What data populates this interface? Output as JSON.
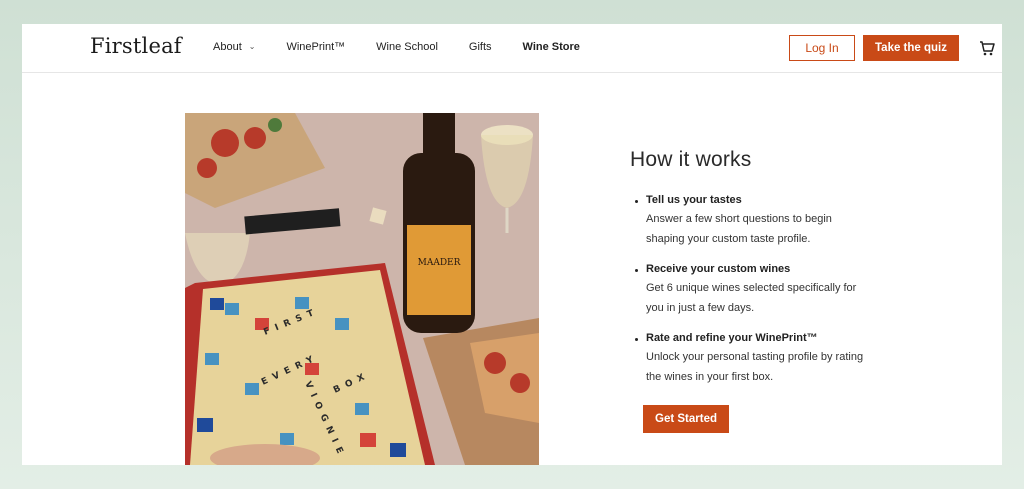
{
  "header": {
    "logo": "Firstleaf",
    "nav": [
      {
        "label": "About",
        "has_dropdown": true
      },
      {
        "label": "WinePrint™"
      },
      {
        "label": "Wine School"
      },
      {
        "label": "Gifts"
      },
      {
        "label": "Wine Store",
        "bold": true
      }
    ],
    "login_label": "Log In",
    "quiz_label": "Take the quiz",
    "cart_icon": "cart-icon"
  },
  "main": {
    "title": "How it works",
    "steps": [
      {
        "title": "Tell us your tastes",
        "desc_line1": "Answer a few short questions to begin",
        "desc_line2": "shaping your custom taste profile."
      },
      {
        "title": "Receive your custom wines",
        "desc_line1": "Get 6 unique wines selected specifically for",
        "desc_line2": "you in just a few days."
      },
      {
        "title": "Rate and refine your WinePrint™",
        "desc_line1": "Unlock your personal tasting profile by rating",
        "desc_line2": "the wines in your first box."
      }
    ],
    "cta_label": "Get Started"
  },
  "photo": {
    "bottle_label": "MAADER",
    "tiles_word1": "FIRST",
    "tiles_word2": "EVERY",
    "tiles_word3": "BOX",
    "tiles_word4": "VIOGNIE"
  },
  "colors": {
    "accent": "#c94a17",
    "background": "#e3eee6"
  }
}
